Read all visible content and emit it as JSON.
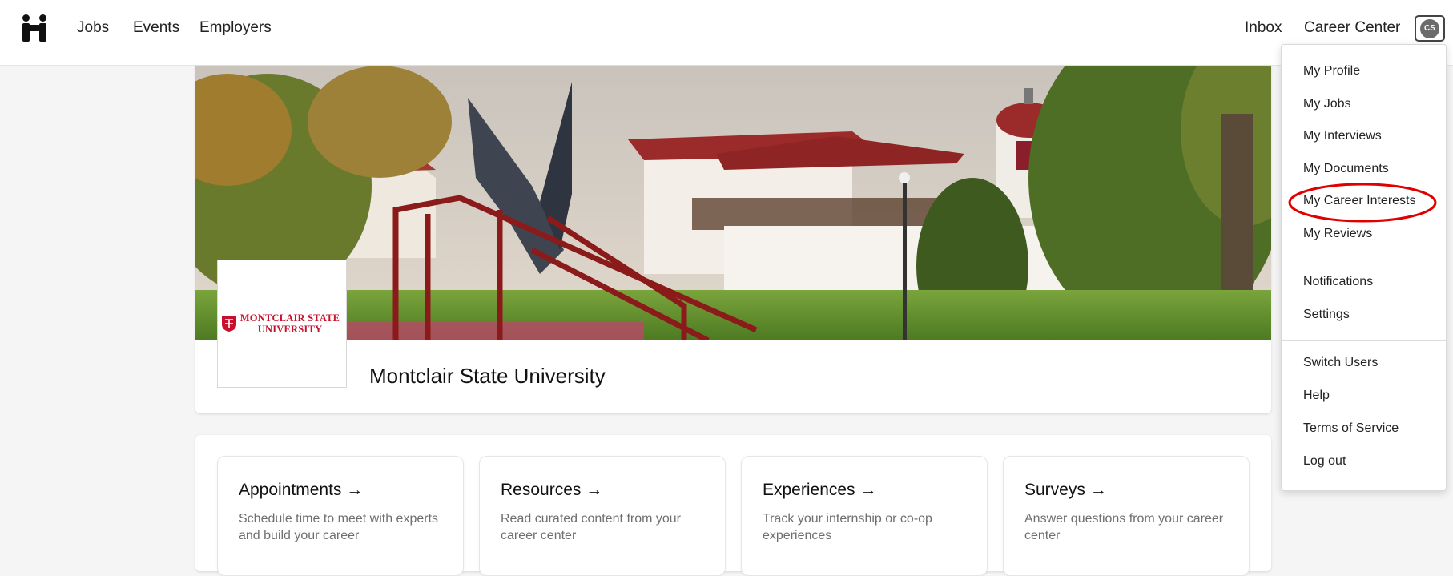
{
  "nav": {
    "logo_icon": "handshake-logo-icon",
    "links": [
      "Jobs",
      "Events",
      "Employers"
    ],
    "inbox": "Inbox",
    "career_center": "Career Center",
    "avatar_initials": "CS"
  },
  "profile": {
    "logo_text_line1": "MONTCLAIR STATE",
    "logo_text_line2": "UNIVERSITY",
    "school_name": "Montclair State University",
    "brand_color": "#c8102e"
  },
  "features": [
    {
      "title": "Appointments →",
      "description": "Schedule time to meet with experts and build your career"
    },
    {
      "title": "Resources →",
      "description": "Read curated content from your career center"
    },
    {
      "title": "Experiences →",
      "description": "Track your internship or co-op experiences"
    },
    {
      "title": "Surveys →",
      "description": "Answer questions from your career center"
    }
  ],
  "dropdown": {
    "group1": [
      "My Profile",
      "My Jobs",
      "My Interviews",
      "My Documents",
      "My Career Interests",
      "My Reviews"
    ],
    "group2": [
      "Notifications",
      "Settings"
    ],
    "group3": [
      "Switch Users",
      "Help",
      "Terms of Service",
      "Log out"
    ],
    "highlighted_item": "My Career Interests",
    "highlight_color": "#e00000"
  }
}
